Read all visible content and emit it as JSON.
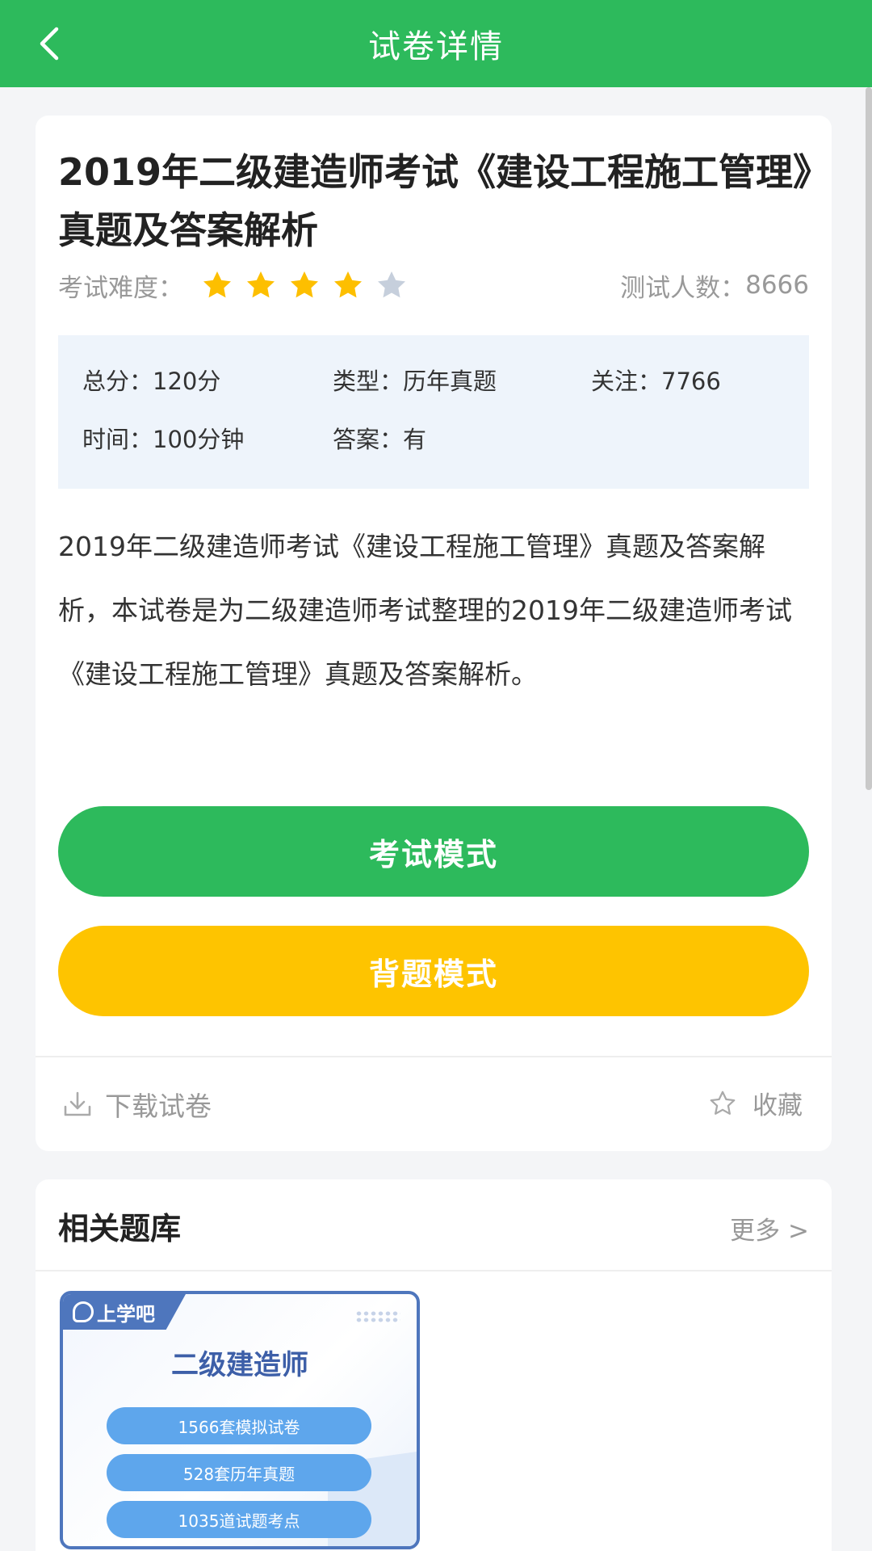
{
  "header": {
    "title": "试卷详情"
  },
  "paper": {
    "title": "2019年二级建造师考试《建设工程施工管理》真题及答案解析",
    "difficulty_label": "考试难度：",
    "difficulty_rating": 4,
    "difficulty_max": 5,
    "takers_label": "测试人数：",
    "takers_count": "8666",
    "info": {
      "total_score": "总分：120分",
      "type": "类型：历年真题",
      "followers": "关注：7766",
      "time": "时间：100分钟",
      "answer": "答案：有"
    },
    "description": "2019年二级建造师考试《建设工程施工管理》真题及答案解析，本试卷是为二级建造师考试整理的2019年二级建造师考试《建设工程施工管理》真题及答案解析。"
  },
  "actions": {
    "exam_mode": "考试模式",
    "review_mode": "背题模式",
    "download": "下载试卷",
    "favorite": "收藏"
  },
  "related": {
    "title": "相关题库",
    "more": "更多 >",
    "bank": {
      "brand": "上学吧",
      "name": "二级建造师",
      "items": [
        "1566套模拟试卷",
        "528套历年真题",
        "1035道试题考点"
      ]
    }
  },
  "colors": {
    "primary_green": "#2dba5c",
    "accent_yellow": "#fec400",
    "star_filled": "#fdbf00",
    "star_empty": "#c6cfdc",
    "bank_blue": "#4e76bd"
  }
}
